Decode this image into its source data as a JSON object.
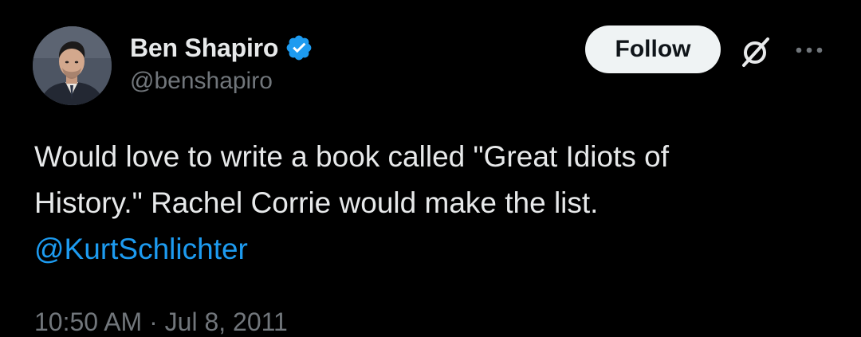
{
  "author": {
    "display_name": "Ben Shapiro",
    "handle": "@benshapiro",
    "verified": true,
    "verified_icon": "verified-badge-icon"
  },
  "actions": {
    "follow_label": "Follow",
    "grok_icon": "grok-icon",
    "more_icon": "more-options-icon"
  },
  "tweet": {
    "text_line_1": "Would love to write a book called \"Great Idiots of",
    "text_line_2": "History.\" Rachel Corrie would make the list.",
    "mention": "@KurtSchlichter",
    "timestamp": "10:50 AM · Jul 8, 2011"
  },
  "colors": {
    "background": "#000000",
    "text_primary": "#e7e9ea",
    "text_secondary": "#71767b",
    "accent": "#1d9bf0",
    "follow_button_bg": "#eff3f4",
    "follow_button_text": "#0f1419"
  }
}
